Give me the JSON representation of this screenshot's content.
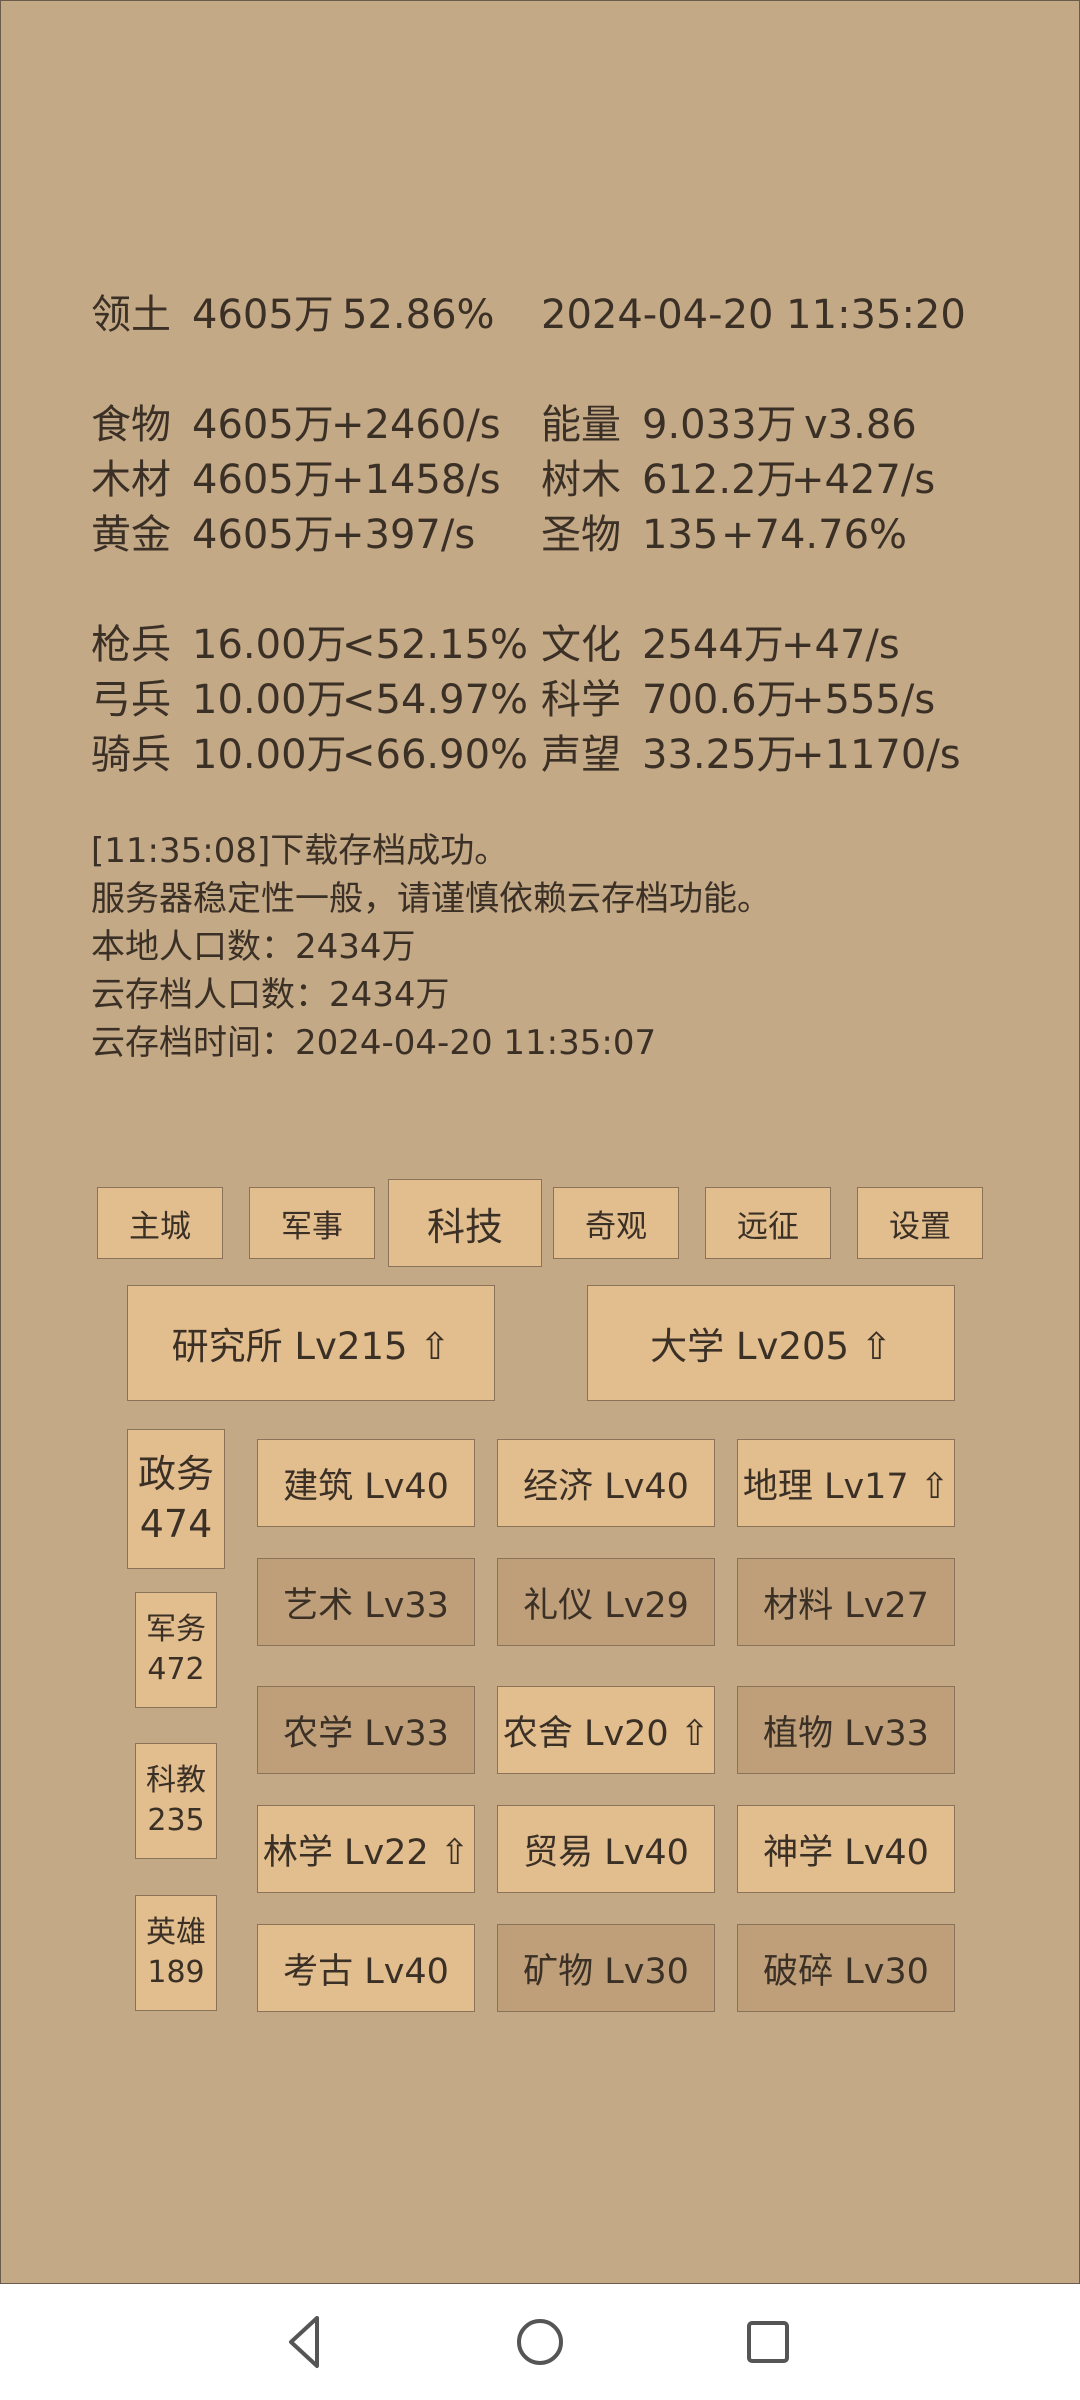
{
  "territory": {
    "label": "领土",
    "amount": "4605万",
    "percent": "52.86%",
    "datetime": "2024-04-20 11:35:20"
  },
  "resources_left": [
    {
      "name": "食物",
      "amount": "4605万",
      "rate": "+2460/s"
    },
    {
      "name": "木材",
      "amount": "4605万",
      "rate": "+1458/s"
    },
    {
      "name": "黄金",
      "amount": "4605万",
      "rate": "+397/s"
    }
  ],
  "resources_right": [
    {
      "name": "能量",
      "amount": "9.033万",
      "rate": "v3.86"
    },
    {
      "name": "树木",
      "amount": "612.2万",
      "rate": "+427/s"
    },
    {
      "name": "圣物",
      "amount": "135",
      "rate": "+74.76%"
    }
  ],
  "troops": [
    {
      "name": "枪兵",
      "amount": "16.00万",
      "rate": "<52.15%"
    },
    {
      "name": "弓兵",
      "amount": "10.00万",
      "rate": "<54.97%"
    },
    {
      "name": "骑兵",
      "amount": "10.00万",
      "rate": "<66.90%"
    }
  ],
  "stats_right": [
    {
      "name": "文化",
      "amount": "2544万",
      "rate": "+47/s"
    },
    {
      "name": "科学",
      "amount": "700.6万",
      "rate": "+555/s"
    },
    {
      "name": "声望",
      "amount": "33.25万",
      "rate": "+1170/s"
    }
  ],
  "log": [
    "[11:35:08]下载存档成功。",
    "服务器稳定性一般，请谨慎依赖云存档功能。",
    "本地人口数：2434万",
    "云存档人口数：2434万",
    "云存档时间：2024-04-20 11:35:07"
  ],
  "tabs": [
    "主城",
    "军事",
    "科技",
    "奇观",
    "远征",
    "设置"
  ],
  "buildings": [
    "研究所 Lv215 ⇧",
    "大学 Lv205 ⇧"
  ],
  "categories": [
    {
      "name": "政务",
      "count": "474"
    },
    {
      "name": "军务",
      "count": "472"
    },
    {
      "name": "科教",
      "count": "235"
    },
    {
      "name": "英雄",
      "count": "189"
    }
  ],
  "techs": [
    "建筑 Lv40",
    "经济 Lv40",
    "地理 Lv17 ⇧",
    "艺术 Lv33",
    "礼仪 Lv29",
    "材料 Lv27",
    "农学 Lv33",
    "农舍 Lv20 ⇧",
    "植物 Lv33",
    "林学 Lv22 ⇧",
    "贸易 Lv40",
    "神学 Lv40",
    "考古 Lv40",
    "矿物 Lv30",
    "破碎 Lv30"
  ]
}
